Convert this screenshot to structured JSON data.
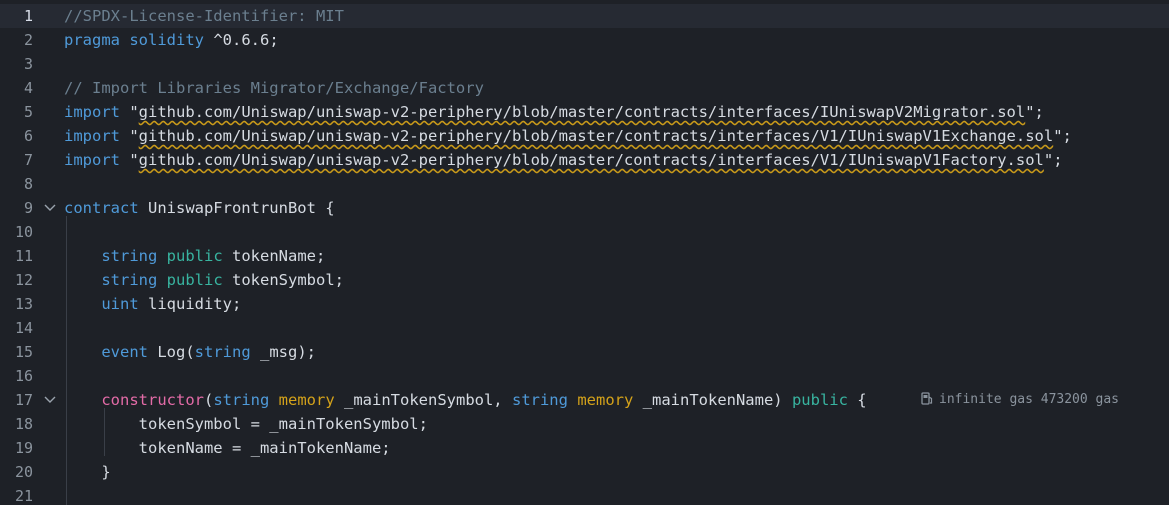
{
  "lines": [
    {
      "num": "1",
      "parts": [
        {
          "t": "//SPDX-License-Identifier: MIT",
          "c": "comment"
        }
      ]
    },
    {
      "num": "2",
      "parts": [
        {
          "t": "pragma",
          "c": "kw"
        },
        {
          "t": " ",
          "c": "plain"
        },
        {
          "t": "solidity",
          "c": "kw"
        },
        {
          "t": " ^0.6.6;",
          "c": "plain"
        }
      ]
    },
    {
      "num": "3",
      "parts": []
    },
    {
      "num": "4",
      "parts": [
        {
          "t": "// Import Libraries Migrator/Exchange/Factory",
          "c": "comment"
        }
      ]
    },
    {
      "num": "5",
      "parts": [
        {
          "t": "import",
          "c": "kw"
        },
        {
          "t": " \"",
          "c": "plain"
        },
        {
          "t": "github.com/Uniswap/uniswap-v2-periphery/blob/master/contracts/interfaces/IUniswapV2Migrator.sol",
          "c": "str"
        },
        {
          "t": "\";",
          "c": "plain"
        }
      ]
    },
    {
      "num": "6",
      "parts": [
        {
          "t": "import",
          "c": "kw"
        },
        {
          "t": " \"",
          "c": "plain"
        },
        {
          "t": "github.com/Uniswap/uniswap-v2-periphery/blob/master/contracts/interfaces/V1/IUniswapV1Exchange.sol",
          "c": "str"
        },
        {
          "t": "\";",
          "c": "plain"
        }
      ]
    },
    {
      "num": "7",
      "parts": [
        {
          "t": "import",
          "c": "kw"
        },
        {
          "t": " \"",
          "c": "plain"
        },
        {
          "t": "github.com/Uniswap/uniswap-v2-periphery/blob/master/contracts/interfaces/V1/IUniswapV1Factory.sol",
          "c": "str"
        },
        {
          "t": "\";",
          "c": "plain"
        }
      ]
    },
    {
      "num": "8",
      "parts": []
    },
    {
      "num": "9",
      "fold": true,
      "parts": [
        {
          "t": "contract",
          "c": "kw"
        },
        {
          "t": " UniswapFrontrunBot {",
          "c": "plain"
        }
      ]
    },
    {
      "num": "10",
      "parts": []
    },
    {
      "num": "11",
      "parts": [
        {
          "t": "    ",
          "c": "plain"
        },
        {
          "t": "string",
          "c": "type"
        },
        {
          "t": " ",
          "c": "plain"
        },
        {
          "t": "public",
          "c": "mod"
        },
        {
          "t": " tokenName;",
          "c": "plain"
        }
      ]
    },
    {
      "num": "12",
      "parts": [
        {
          "t": "    ",
          "c": "plain"
        },
        {
          "t": "string",
          "c": "type"
        },
        {
          "t": " ",
          "c": "plain"
        },
        {
          "t": "public",
          "c": "mod"
        },
        {
          "t": " tokenSymbol;",
          "c": "plain"
        }
      ]
    },
    {
      "num": "13",
      "parts": [
        {
          "t": "    ",
          "c": "plain"
        },
        {
          "t": "uint",
          "c": "type"
        },
        {
          "t": " liquidity;",
          "c": "plain"
        }
      ]
    },
    {
      "num": "14",
      "parts": []
    },
    {
      "num": "15",
      "parts": [
        {
          "t": "    ",
          "c": "plain"
        },
        {
          "t": "event",
          "c": "kw"
        },
        {
          "t": " Log(",
          "c": "plain"
        },
        {
          "t": "string",
          "c": "type"
        },
        {
          "t": " _msg);",
          "c": "plain"
        }
      ]
    },
    {
      "num": "16",
      "parts": []
    },
    {
      "num": "17",
      "fold": true,
      "gas": true,
      "parts": [
        {
          "t": "    ",
          "c": "plain"
        },
        {
          "t": "constructor",
          "c": "ctor"
        },
        {
          "t": "(",
          "c": "plain"
        },
        {
          "t": "string",
          "c": "type"
        },
        {
          "t": " ",
          "c": "plain"
        },
        {
          "t": "memory",
          "c": "mem"
        },
        {
          "t": " _mainTokenSymbol, ",
          "c": "plain"
        },
        {
          "t": "string",
          "c": "type"
        },
        {
          "t": " ",
          "c": "plain"
        },
        {
          "t": "memory",
          "c": "mem"
        },
        {
          "t": " _mainTokenName) ",
          "c": "plain"
        },
        {
          "t": "public",
          "c": "mod"
        },
        {
          "t": " {",
          "c": "plain"
        }
      ]
    },
    {
      "num": "18",
      "parts": [
        {
          "t": "        tokenSymbol = _mainTokenSymbol;",
          "c": "plain"
        }
      ]
    },
    {
      "num": "19",
      "parts": [
        {
          "t": "        tokenName = _mainTokenName;",
          "c": "plain"
        }
      ]
    },
    {
      "num": "20",
      "parts": [
        {
          "t": "    }",
          "c": "plain"
        }
      ]
    },
    {
      "num": "21",
      "parts": []
    }
  ],
  "gas_estimate": "infinite gas 473200 gas",
  "icons": {
    "fold": "chevron-down-icon",
    "gas": "gas-pump-icon"
  },
  "colors": {
    "background": "#1e2127",
    "keyword": "#4f9ad9",
    "modifier": "#38b4a0",
    "memory": "#d4a21a",
    "constructor": "#e36ba7",
    "comment": "#6b7f8f",
    "warning_squiggle": "#c99a1a"
  }
}
